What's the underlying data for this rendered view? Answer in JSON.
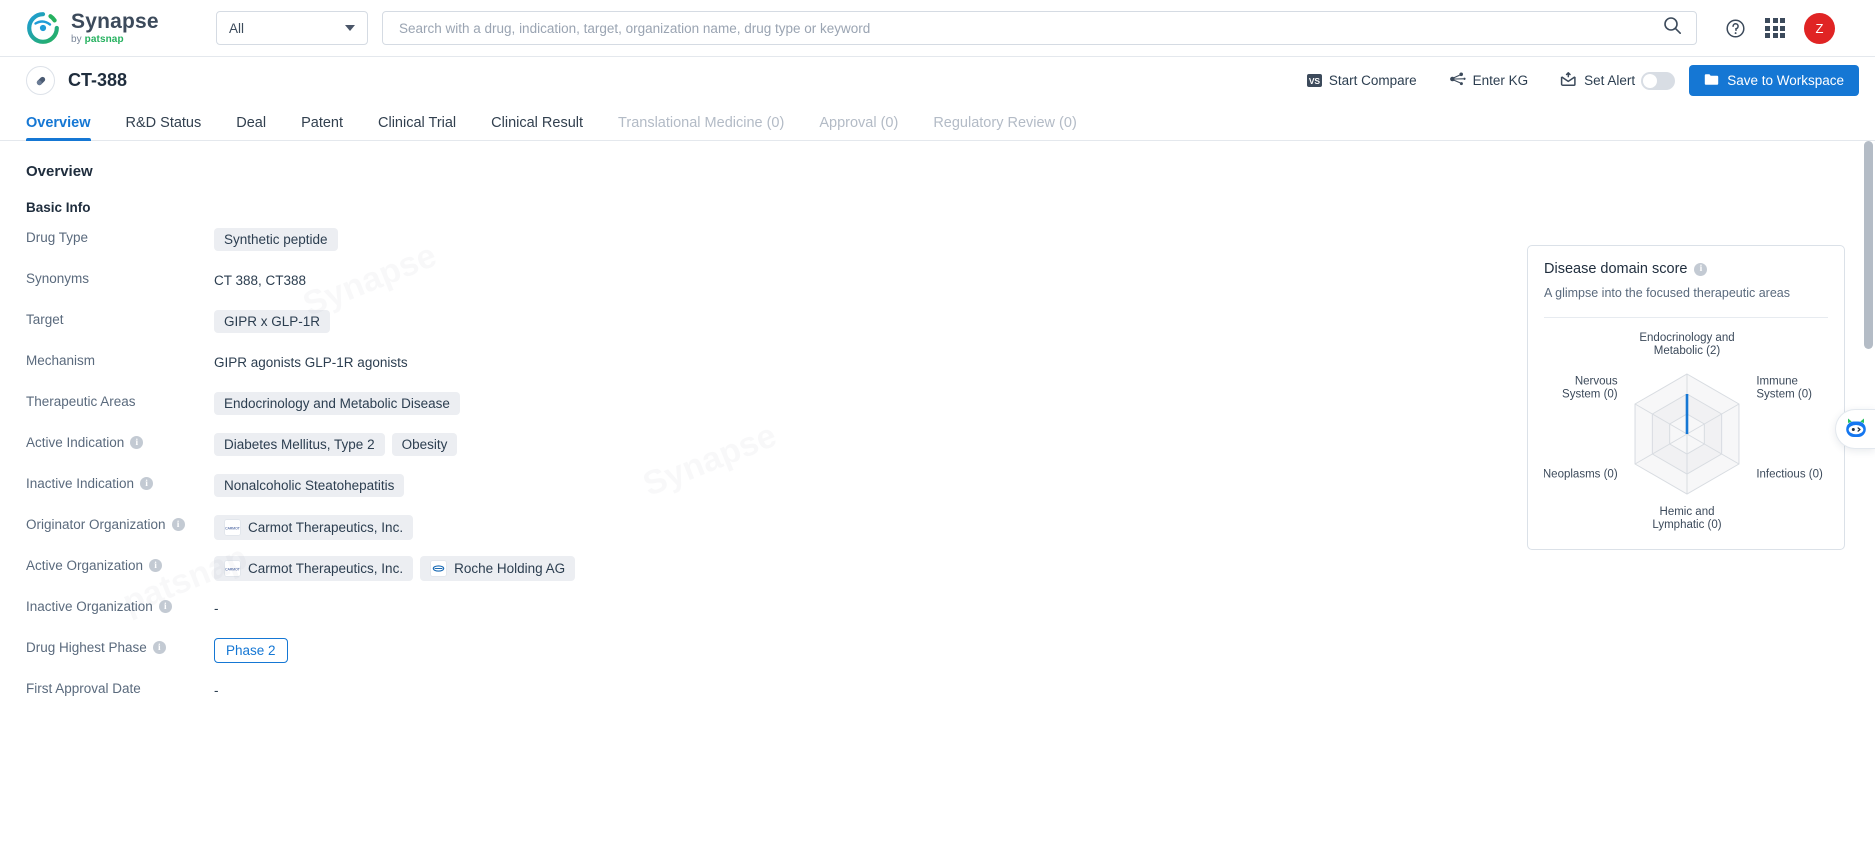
{
  "topbar": {
    "brand_name": "Synapse",
    "brand_sub_prefix": "by ",
    "brand_sub_name": "patsnap",
    "scope_value": "All",
    "search_placeholder": "Search with a drug, indication, target, organization name, drug type or keyword",
    "search_value": "",
    "help_icon": "question-circle-icon",
    "apps_icon": "apps-grid-icon",
    "avatar_initial": "Z",
    "avatar_color": "#e02424"
  },
  "drugbar": {
    "drug_icon": "pill-capsule-icon",
    "title": "CT-388",
    "actions": [
      {
        "label": "Start Compare",
        "icon": "vs-badge-icon",
        "badge": "VS"
      },
      {
        "label": "Enter KG",
        "icon": "knowledge-graph-icon"
      },
      {
        "label": "Set Alert",
        "icon": "bell-mail-icon"
      }
    ],
    "alert_toggle_on": false,
    "save_label": "Save to Workspace",
    "save_icon": "folder-icon",
    "accent_color": "#1577d4"
  },
  "tabs": [
    {
      "label": "Overview",
      "state": "active"
    },
    {
      "label": "R&D Status",
      "state": "normal"
    },
    {
      "label": "Deal",
      "state": "normal"
    },
    {
      "label": "Patent",
      "state": "normal"
    },
    {
      "label": "Clinical Trial",
      "state": "normal"
    },
    {
      "label": "Clinical Result",
      "state": "normal"
    },
    {
      "label": "Translational Medicine (0)",
      "state": "disabled"
    },
    {
      "label": "Approval (0)",
      "state": "disabled"
    },
    {
      "label": "Regulatory Review (0)",
      "state": "disabled"
    }
  ],
  "main": {
    "section_title": "Overview",
    "subsection_title": "Basic Info",
    "fields": [
      {
        "label": "Drug Type",
        "info": false,
        "type": "chips",
        "values": [
          "Synthetic peptide"
        ]
      },
      {
        "label": "Synonyms",
        "info": false,
        "type": "text",
        "text": "CT 388,  CT388"
      },
      {
        "label": "Target",
        "info": false,
        "type": "chips",
        "values": [
          "GIPR x GLP-1R"
        ]
      },
      {
        "label": "Mechanism",
        "info": false,
        "type": "text",
        "text": "GIPR agonists  GLP-1R agonists"
      },
      {
        "label": "Therapeutic Areas",
        "info": false,
        "type": "chips",
        "values": [
          "Endocrinology and Metabolic Disease"
        ]
      },
      {
        "label": "Active Indication",
        "info": true,
        "type": "chips",
        "values": [
          "Diabetes Mellitus, Type 2",
          "Obesity"
        ]
      },
      {
        "label": "Inactive Indication",
        "info": true,
        "type": "chips",
        "values": [
          "Nonalcoholic Steatohepatitis"
        ]
      },
      {
        "label": "Originator Organization",
        "info": true,
        "type": "orgs",
        "values": [
          "Carmot Therapeutics, Inc."
        ]
      },
      {
        "label": "Active Organization",
        "info": true,
        "type": "orgs",
        "values": [
          "Carmot Therapeutics, Inc.",
          "Roche Holding AG"
        ]
      },
      {
        "label": "Inactive Organization",
        "info": true,
        "type": "dash",
        "text": "-"
      },
      {
        "label": "Drug Highest Phase",
        "info": true,
        "type": "phase",
        "values": [
          "Phase 2"
        ]
      },
      {
        "label": "First Approval Date",
        "info": false,
        "type": "dash",
        "text": "-"
      }
    ]
  },
  "radar_card": {
    "title": "Disease domain score",
    "info_icon": "info-circle-icon",
    "description": "A glimpse into the focused therapeutic areas"
  },
  "chart_data": {
    "type": "radar",
    "title": "Disease domain score",
    "subtitle": "A glimpse into the focused therapeutic areas",
    "categories": [
      "Endocrinology and Metabolic",
      "Immune System",
      "Infectious",
      "Hemic and Lymphatic",
      "Neoplasms",
      "Nervous System"
    ],
    "tick_labels": [
      "Endocrinology and\nMetabolic (2)",
      "Immune\nSystem (0)",
      "Infectious (0)",
      "Hemic and\nLymphatic (0)",
      "Neoplasms (0)",
      "Nervous\nSystem (0)"
    ],
    "values": [
      2,
      0,
      0,
      0,
      0,
      0
    ],
    "rmax": 3,
    "rings": 3,
    "grid": true,
    "legend": "none",
    "series_color": "#1577d4",
    "grid_color": "#d8dce1"
  },
  "assistant": {
    "icon": "robot-assistant-icon"
  },
  "scroll": {
    "position": "top"
  }
}
